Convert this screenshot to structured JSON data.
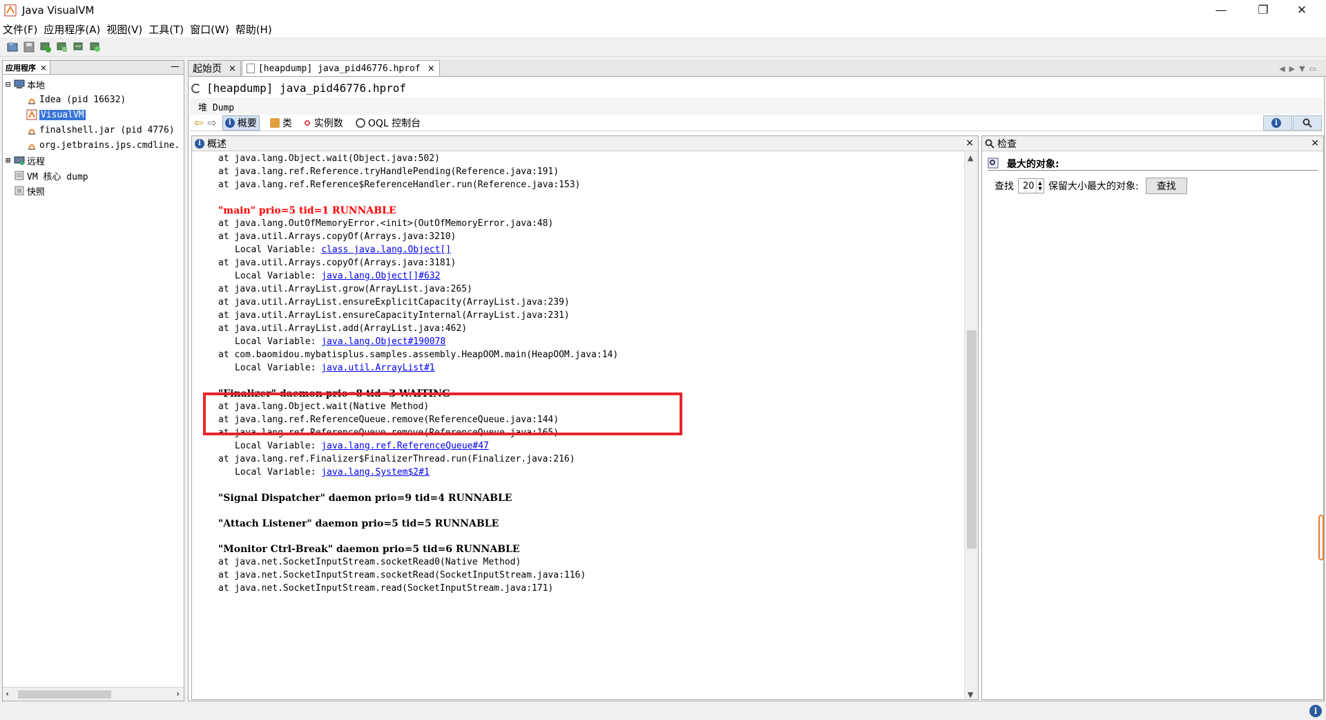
{
  "window": {
    "title": "Java VisualVM",
    "minimize": "—",
    "maximize": "❐",
    "close": "✕"
  },
  "menu": [
    "文件(F)",
    "应用程序(A)",
    "视图(V)",
    "工具(T)",
    "窗口(W)",
    "帮助(H)"
  ],
  "left_panel": {
    "tab": "应用程序",
    "close": "×",
    "minimize": "—",
    "tree": {
      "local": "本地",
      "idea": "Idea (pid 16632)",
      "visualvm": "VisualVM",
      "finalshell": "finalshell.jar (pid 4776)",
      "jetbrains": "org.jetbrains.jps.cmdline.",
      "remote": "远程",
      "vm_core": "VM 核心 dump",
      "snapshot": "快照"
    }
  },
  "tabs": [
    {
      "label": "起始页",
      "close": "×"
    },
    {
      "label": "[heapdump] java_pid46776.hprof",
      "close": "×"
    }
  ],
  "document": {
    "title": "[heapdump] java_pid46776.hprof",
    "subtitle": "堆 Dump",
    "views": [
      "概要",
      "类",
      "实例数",
      "OQL 控制台"
    ]
  },
  "overview": {
    "title": "概述",
    "close": "×",
    "lines": [
      {
        "text": "at java.lang.Object.wait(Object.java:502)"
      },
      {
        "text": "at java.lang.ref.Reference.tryHandlePending(Reference.java:191)"
      },
      {
        "text": "at java.lang.ref.Reference$ReferenceHandler.run(Reference.java:153)"
      },
      {
        "text": "\"main\" prio=5 tid=1 RUNNABLE"
      },
      {
        "text": "at java.lang.OutOfMemoryError.<init>(OutOfMemoryError.java:48)"
      },
      {
        "text": "at java.util.Arrays.copyOf(Arrays.java:3210)"
      },
      {
        "prefix": "Local Variable: ",
        "link": "class java.lang.Object[]"
      },
      {
        "text": "at java.util.Arrays.copyOf(Arrays.java:3181)"
      },
      {
        "prefix": "Local Variable: ",
        "link": "java.lang.Object[]#632"
      },
      {
        "text": "at java.util.ArrayList.grow(ArrayList.java:265)"
      },
      {
        "text": "at java.util.ArrayList.ensureExplicitCapacity(ArrayList.java:239)"
      },
      {
        "text": "at java.util.ArrayList.ensureCapacityInternal(ArrayList.java:231)"
      },
      {
        "text": "at java.util.ArrayList.add(ArrayList.java:462)"
      },
      {
        "prefix": "Local Variable: ",
        "link": "java.lang.Object#190078"
      },
      {
        "text": "at com.baomidou.mybatisplus.samples.assembly.HeapOOM.main(HeapOOM.java:14)"
      },
      {
        "prefix": "Local Variable: ",
        "link": "java.util.ArrayList#1"
      },
      {
        "text": "\"Finalizer\" daemon prio=8 tid=3 WAITING"
      },
      {
        "text": "at java.lang.Object.wait(Native Method)"
      },
      {
        "text": "at java.lang.ref.ReferenceQueue.remove(ReferenceQueue.java:144)"
      },
      {
        "text": "at java.lang.ref.ReferenceQueue.remove(ReferenceQueue.java:165)"
      },
      {
        "prefix": "Local Variable: ",
        "link": "java.lang.ref.ReferenceQueue#47"
      },
      {
        "text": "at java.lang.ref.Finalizer$FinalizerThread.run(Finalizer.java:216)"
      },
      {
        "prefix": "Local Variable: ",
        "link": "java.lang.System$2#1"
      },
      {
        "text": "\"Signal Dispatcher\" daemon prio=9 tid=4 RUNNABLE"
      },
      {
        "text": "\"Attach Listener\" daemon prio=5 tid=5 RUNNABLE"
      },
      {
        "text": "\"Monitor Ctrl-Break\" daemon prio=5 tid=6 RUNNABLE"
      },
      {
        "text": "at java.net.SocketInputStream.socketRead0(Native Method)"
      },
      {
        "text": "at java.net.SocketInputStream.socketRead(SocketInputStream.java:116)"
      },
      {
        "text": "at java.net.SocketInputStream.read(SocketInputStream.java:171)"
      }
    ]
  },
  "inspect": {
    "title": "检查",
    "close": "×",
    "heading": "最大的对象:",
    "find_label": "查找",
    "count": "20",
    "suffix": "保留大小最大的对象:",
    "button": "查找"
  },
  "colors": {
    "accent": "#3875d7",
    "highlight": "#e8242b",
    "error_thread": "#ff0000",
    "link": "#0000ee"
  }
}
